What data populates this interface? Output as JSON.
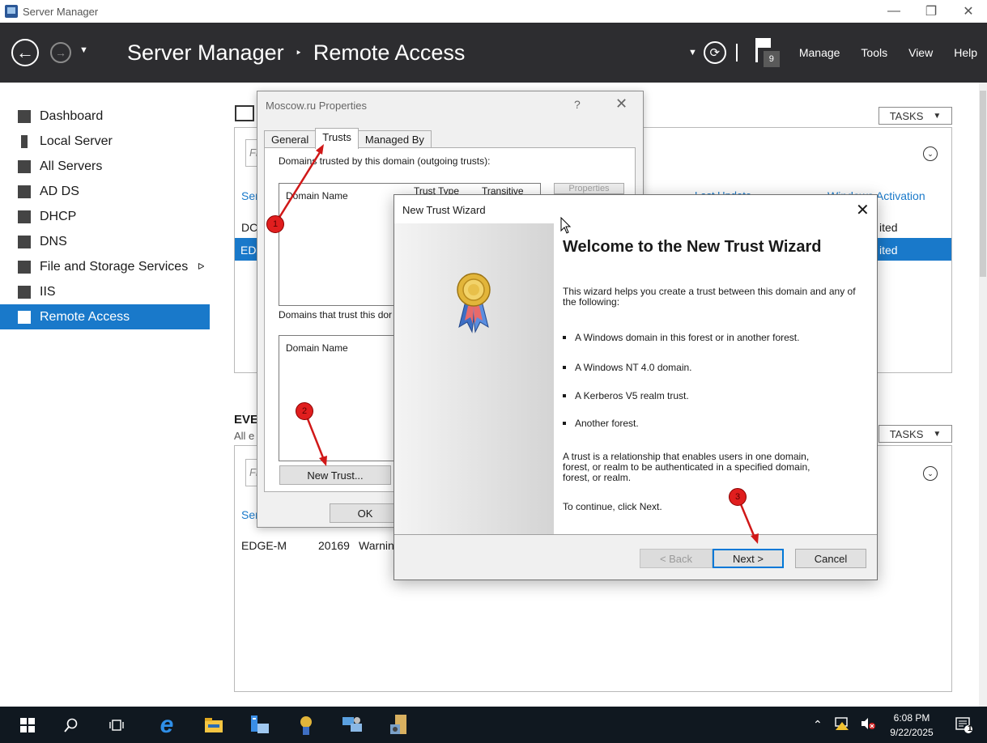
{
  "window": {
    "title": "Server Manager",
    "controls": {
      "minimize": "—",
      "restore": "❐",
      "close": "✕"
    }
  },
  "header": {
    "breadcrumb_root": "Server Manager",
    "breadcrumb_separator": "‣",
    "breadcrumb_current": "Remote Access",
    "notification_count": "9",
    "menu": [
      "Manage",
      "Tools",
      "View",
      "Help"
    ]
  },
  "sidebar": {
    "items": [
      {
        "label": "Dashboard",
        "icon": "dashboard-icon"
      },
      {
        "label": "Local Server",
        "icon": "server-icon"
      },
      {
        "label": "All Servers",
        "icon": "servers-icon"
      },
      {
        "label": "AD DS",
        "icon": "ad-ds-icon"
      },
      {
        "label": "DHCP",
        "icon": "dhcp-icon"
      },
      {
        "label": "DNS",
        "icon": "dns-icon"
      },
      {
        "label": "File and Storage Services",
        "icon": "storage-icon",
        "expand": "ᐅ"
      },
      {
        "label": "IIS",
        "icon": "iis-icon"
      },
      {
        "label": "Remote Access",
        "icon": "remote-access-icon",
        "active": true
      }
    ]
  },
  "main": {
    "tasks_label": "TASKS",
    "servers_tile": {
      "filter_placeholder": "Fi",
      "col_server_fragment": "Ser",
      "col_last_update_fragment": "Last Update",
      "col_activation_fragment": "Windows Activation",
      "row1_fragment": "DC",
      "row1_status_fragment": "ited",
      "row2_fragment": "EDG",
      "row2_status_fragment": "ited"
    },
    "events_tile": {
      "title_fragment": "EVE",
      "subtitle_fragment": "All e",
      "filter_placeholder": "Fi",
      "col_server_fragment": "Ser",
      "row_server": "EDGE-M",
      "row_id": "20169",
      "row_severity_fragment": "Warnin"
    }
  },
  "properties_dialog": {
    "title": "Moscow.ru Properties",
    "help": "?",
    "close": "✕",
    "tabs": [
      "General",
      "Trusts",
      "Managed By"
    ],
    "active_tab": "Trusts",
    "outgoing_label": "Domains trusted by this domain (outgoing trusts):",
    "outgoing_columns": [
      "Domain Name",
      "Trust Type",
      "Transitive"
    ],
    "properties_button": "Properties",
    "incoming_label": "Domains that trust this domain (incoming trusts):",
    "incoming_label_visible": "Domains that trust this dor",
    "incoming_columns": [
      "Domain Name"
    ],
    "new_trust_button": "New Trust...",
    "ok_button": "OK"
  },
  "wizard": {
    "title": "New Trust Wizard",
    "close": "✕",
    "heading": "Welcome to the New Trust Wizard",
    "intro": "This wizard helps you create a trust between this domain and any of the following:",
    "bullets": [
      "A Windows domain in this forest or in another forest.",
      "A Windows NT 4.0 domain.",
      "A Kerberos V5 realm trust.",
      "Another forest."
    ],
    "definition": "A trust is a relationship that enables users in one domain, forest, or realm to be authenticated in a specified domain, forest, or realm.",
    "continue_text": "To continue, click Next.",
    "back_button": "< Back",
    "next_button": "Next >",
    "cancel_button": "Cancel"
  },
  "annotations": [
    "1",
    "2",
    "3"
  ],
  "taskbar": {
    "items": [
      "start-icon",
      "search-icon",
      "task-view-icon",
      "internet-explorer-icon",
      "file-explorer-icon",
      "server-manager-icon",
      "ad-trusts-icon",
      "ad-users-computers-icon",
      "admin-tools-icon"
    ],
    "time": "6:08 PM",
    "date": "9/22/2025",
    "notification_badge": "1"
  },
  "colors": {
    "header_bg": "#2d2d30",
    "accent": "#1979ca",
    "annotation": "#e01e1e",
    "taskbar_bg": "#101820"
  }
}
